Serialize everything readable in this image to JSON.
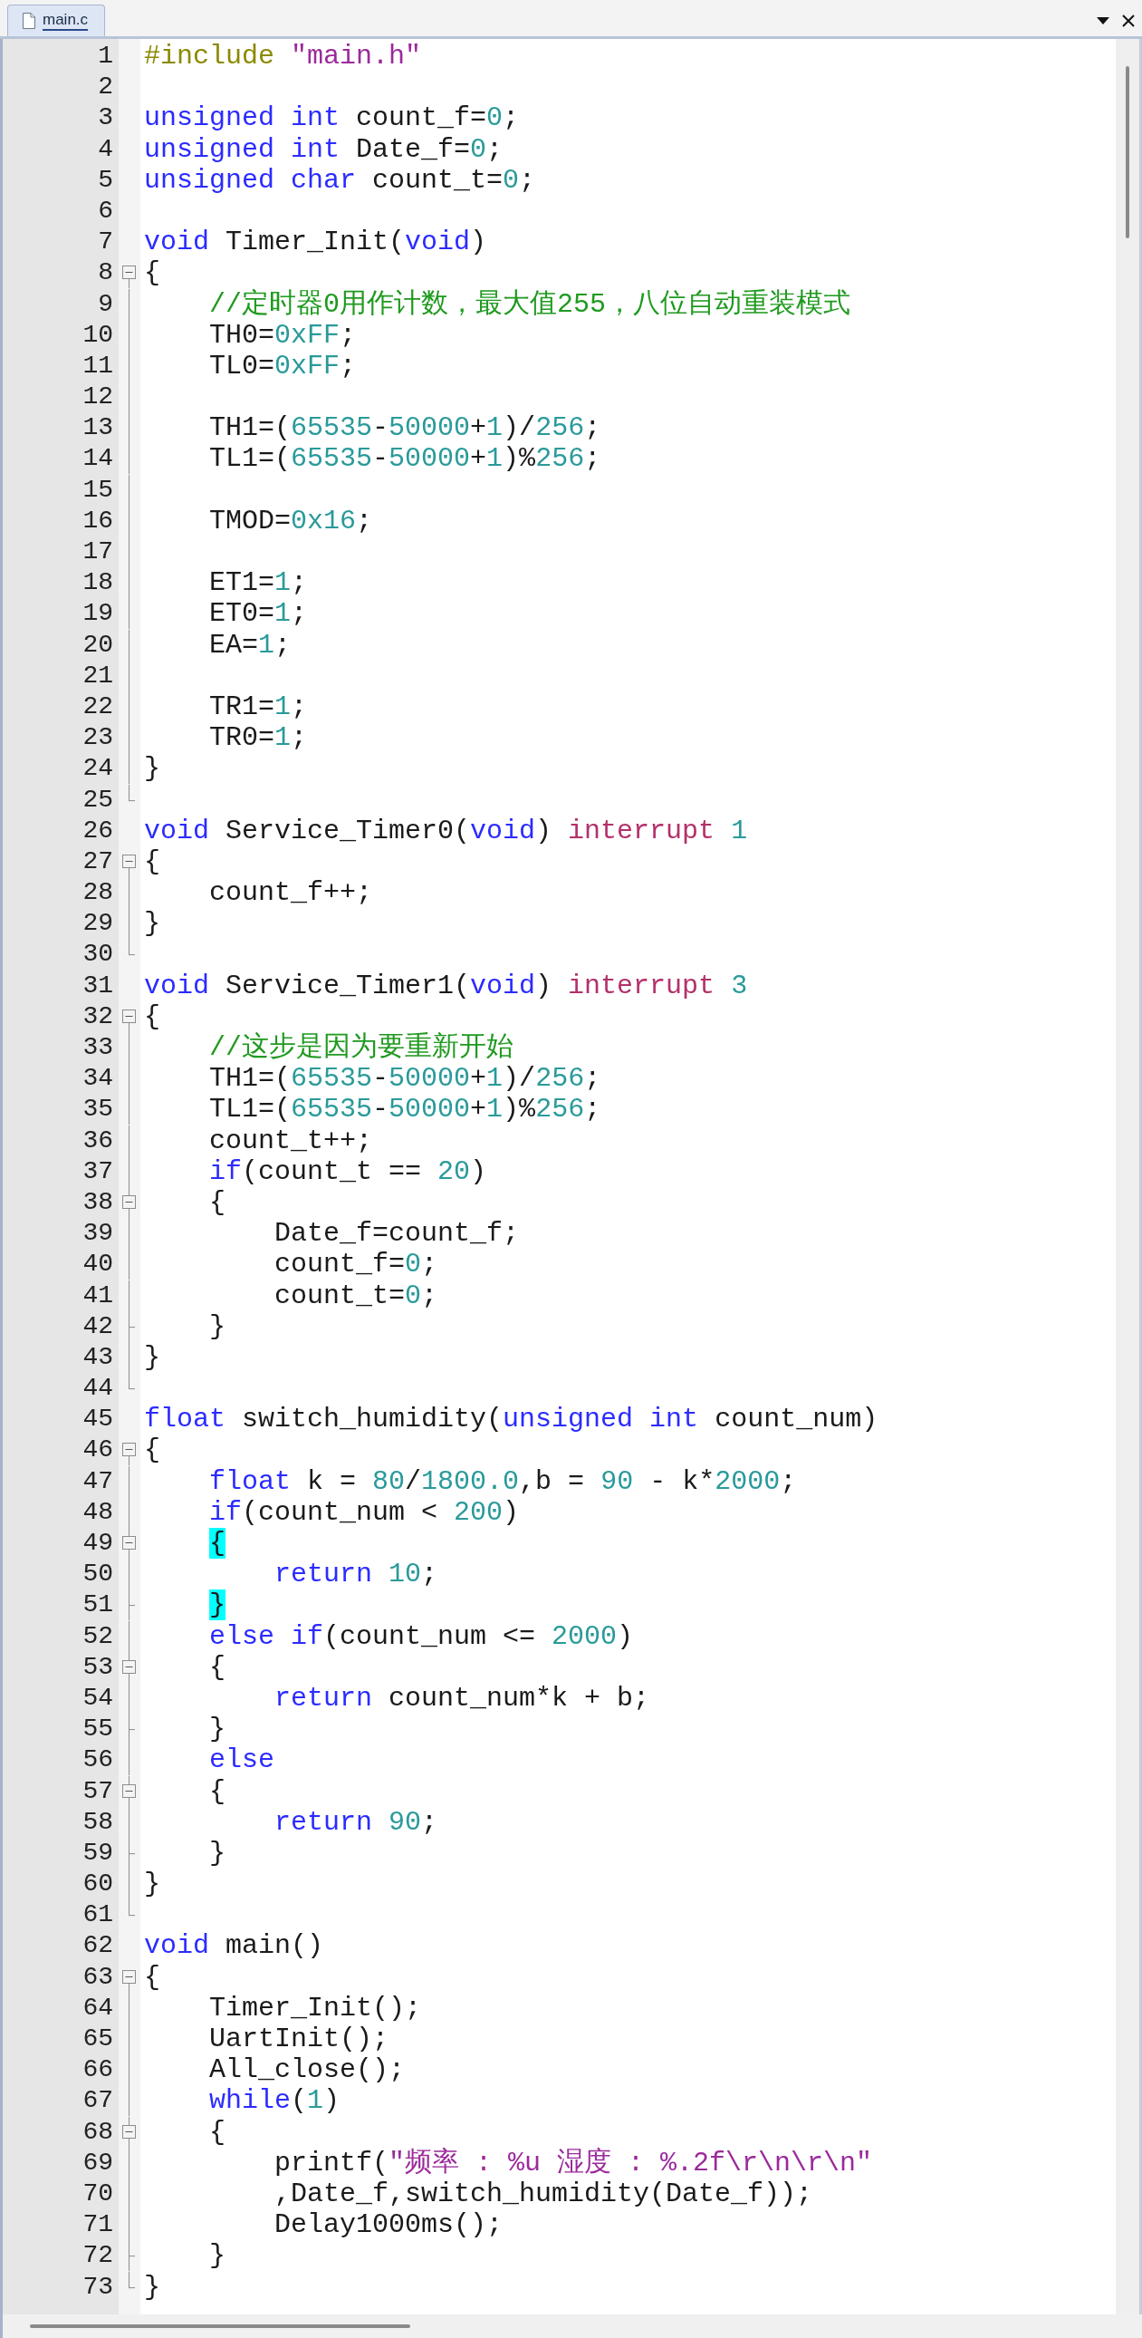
{
  "tab": {
    "label": "main.c",
    "selected": true
  },
  "lines": [
    {
      "number": "1",
      "kind": "code",
      "tokens": [
        {
          "kind": "preproc",
          "text": "#include "
        },
        {
          "kind": "string",
          "text": "\"main.h\""
        }
      ]
    },
    {
      "number": "2",
      "kind": "code"
    },
    {
      "number": "3",
      "kind": "code",
      "tokens": [
        {
          "kind": "keyword",
          "text": "unsigned"
        },
        {
          "kind": "keyword",
          "text": " int"
        },
        {
          "kind": "plain",
          "text": " count_f="
        },
        {
          "kind": "number",
          "text": "0"
        },
        {
          "kind": "plain",
          "text": ";"
        }
      ]
    },
    {
      "number": "4",
      "kind": "code",
      "tokens": [
        {
          "kind": "keyword",
          "text": "unsigned"
        },
        {
          "kind": "keyword",
          "text": " int"
        },
        {
          "kind": "plain",
          "text": " Date_f="
        },
        {
          "kind": "number",
          "text": "0"
        },
        {
          "kind": "plain",
          "text": ";"
        }
      ]
    },
    {
      "number": "5",
      "kind": "code",
      "tokens": [
        {
          "kind": "keyword",
          "text": "unsigned"
        },
        {
          "kind": "keyword",
          "text": " char"
        },
        {
          "kind": "plain",
          "text": " count_t="
        },
        {
          "kind": "number",
          "text": "0"
        },
        {
          "kind": "plain",
          "text": ";"
        }
      ]
    },
    {
      "number": "6",
      "kind": "code"
    },
    {
      "number": "7",
      "kind": "code",
      "tokens": [
        {
          "kind": "keyword",
          "text": "void"
        },
        {
          "kind": "plain",
          "text": " Timer_Init("
        },
        {
          "kind": "keyword",
          "text": "void"
        },
        {
          "kind": "plain",
          "text": ")"
        }
      ]
    },
    {
      "number": "8",
      "kind": "start",
      "expanded": true,
      "tokens": [
        {
          "kind": "plain",
          "text": "{"
        }
      ]
    },
    {
      "number": "9",
      "kind": "body",
      "tokens": [
        {
          "kind": "comment",
          "text": "    //定时器0用作计数，最大值255，八位自动重装模式"
        }
      ]
    },
    {
      "number": "10",
      "kind": "body",
      "tokens": [
        {
          "kind": "plain",
          "text": "    TH0="
        },
        {
          "kind": "number",
          "text": "0xFF"
        },
        {
          "kind": "plain",
          "text": ";"
        }
      ]
    },
    {
      "number": "11",
      "kind": "body",
      "tokens": [
        {
          "kind": "plain",
          "text": "    TL0="
        },
        {
          "kind": "number",
          "text": "0xFF"
        },
        {
          "kind": "plain",
          "text": ";"
        }
      ]
    },
    {
      "number": "12",
      "kind": "body"
    },
    {
      "number": "13",
      "kind": "body",
      "tokens": [
        {
          "kind": "plain",
          "text": "    TH1=("
        },
        {
          "kind": "number",
          "text": "65535"
        },
        {
          "kind": "plain",
          "text": "-"
        },
        {
          "kind": "number",
          "text": "50000"
        },
        {
          "kind": "plain",
          "text": "+"
        },
        {
          "kind": "number",
          "text": "1"
        },
        {
          "kind": "plain",
          "text": ")/"
        },
        {
          "kind": "number",
          "text": "256"
        },
        {
          "kind": "plain",
          "text": ";"
        }
      ]
    },
    {
      "number": "14",
      "kind": "body",
      "tokens": [
        {
          "kind": "plain",
          "text": "    TL1=("
        },
        {
          "kind": "number",
          "text": "65535"
        },
        {
          "kind": "plain",
          "text": "-"
        },
        {
          "kind": "number",
          "text": "50000"
        },
        {
          "kind": "plain",
          "text": "+"
        },
        {
          "kind": "number",
          "text": "1"
        },
        {
          "kind": "plain",
          "text": ")%"
        },
        {
          "kind": "number",
          "text": "256"
        },
        {
          "kind": "plain",
          "text": ";"
        }
      ]
    },
    {
      "number": "15",
      "kind": "body"
    },
    {
      "number": "16",
      "kind": "body",
      "tokens": [
        {
          "kind": "plain",
          "text": "    TMOD="
        },
        {
          "kind": "number",
          "text": "0x16"
        },
        {
          "kind": "plain",
          "text": ";"
        }
      ]
    },
    {
      "number": "17",
      "kind": "body"
    },
    {
      "number": "18",
      "kind": "body",
      "tokens": [
        {
          "kind": "plain",
          "text": "    ET1="
        },
        {
          "kind": "number",
          "text": "1"
        },
        {
          "kind": "plain",
          "text": ";"
        }
      ]
    },
    {
      "number": "19",
      "kind": "body",
      "tokens": [
        {
          "kind": "plain",
          "text": "    ET0="
        },
        {
          "kind": "number",
          "text": "1"
        },
        {
          "kind": "plain",
          "text": ";"
        }
      ]
    },
    {
      "number": "20",
      "kind": "body",
      "tokens": [
        {
          "kind": "plain",
          "text": "    EA="
        },
        {
          "kind": "number",
          "text": "1"
        },
        {
          "kind": "plain",
          "text": ";"
        }
      ]
    },
    {
      "number": "21",
      "kind": "body"
    },
    {
      "number": "22",
      "kind": "body",
      "tokens": [
        {
          "kind": "plain",
          "text": "    TR1="
        },
        {
          "kind": "number",
          "text": "1"
        },
        {
          "kind": "plain",
          "text": ";"
        }
      ]
    },
    {
      "number": "23",
      "kind": "body",
      "tokens": [
        {
          "kind": "plain",
          "text": "    TR0="
        },
        {
          "kind": "number",
          "text": "1"
        },
        {
          "kind": "plain",
          "text": ";"
        }
      ]
    },
    {
      "number": "24",
      "kind": "body",
      "tokens": [
        {
          "kind": "plain",
          "text": "}"
        }
      ]
    },
    {
      "number": "25",
      "kind": "end"
    },
    {
      "number": "26",
      "kind": "code",
      "tokens": [
        {
          "kind": "keyword",
          "text": "void"
        },
        {
          "kind": "plain",
          "text": " Service_Timer0("
        },
        {
          "kind": "keyword",
          "text": "void"
        },
        {
          "kind": "plain",
          "text": ") "
        },
        {
          "kind": "interrupt",
          "text": "interrupt"
        },
        {
          "kind": "number",
          "text": " 1"
        }
      ]
    },
    {
      "number": "27",
      "kind": "start",
      "expanded": true,
      "tokens": [
        {
          "kind": "plain",
          "text": "{"
        }
      ]
    },
    {
      "number": "28",
      "kind": "body",
      "tokens": [
        {
          "kind": "plain",
          "text": "    count_f++;"
        }
      ]
    },
    {
      "number": "29",
      "kind": "body",
      "tokens": [
        {
          "kind": "plain",
          "text": "}"
        }
      ]
    },
    {
      "number": "30",
      "kind": "end"
    },
    {
      "number": "31",
      "kind": "code",
      "tokens": [
        {
          "kind": "keyword",
          "text": "void"
        },
        {
          "kind": "plain",
          "text": " Service_Timer1("
        },
        {
          "kind": "keyword",
          "text": "void"
        },
        {
          "kind": "plain",
          "text": ") "
        },
        {
          "kind": "interrupt",
          "text": "interrupt"
        },
        {
          "kind": "number",
          "text": " 3"
        }
      ]
    },
    {
      "number": "32",
      "kind": "start",
      "expanded": true,
      "tokens": [
        {
          "kind": "plain",
          "text": "{"
        }
      ]
    },
    {
      "number": "33",
      "kind": "body",
      "tokens": [
        {
          "kind": "comment",
          "text": "    //这步是因为要重新开始"
        }
      ]
    },
    {
      "number": "34",
      "kind": "body",
      "tokens": [
        {
          "kind": "plain",
          "text": "    TH1=("
        },
        {
          "kind": "number",
          "text": "65535"
        },
        {
          "kind": "plain",
          "text": "-"
        },
        {
          "kind": "number",
          "text": "50000"
        },
        {
          "kind": "plain",
          "text": "+"
        },
        {
          "kind": "number",
          "text": "1"
        },
        {
          "kind": "plain",
          "text": ")/"
        },
        {
          "kind": "number",
          "text": "256"
        },
        {
          "kind": "plain",
          "text": ";"
        }
      ]
    },
    {
      "number": "35",
      "kind": "body",
      "tokens": [
        {
          "kind": "plain",
          "text": "    TL1=("
        },
        {
          "kind": "number",
          "text": "65535"
        },
        {
          "kind": "plain",
          "text": "-"
        },
        {
          "kind": "number",
          "text": "50000"
        },
        {
          "kind": "plain",
          "text": "+"
        },
        {
          "kind": "number",
          "text": "1"
        },
        {
          "kind": "plain",
          "text": ")%"
        },
        {
          "kind": "number",
          "text": "256"
        },
        {
          "kind": "plain",
          "text": ";"
        }
      ]
    },
    {
      "number": "36",
      "kind": "body",
      "tokens": [
        {
          "kind": "plain",
          "text": "    count_t++;"
        }
      ]
    },
    {
      "number": "37",
      "kind": "body",
      "tokens": [
        {
          "kind": "keyword",
          "text": "    if"
        },
        {
          "kind": "plain",
          "text": "(count_t == "
        },
        {
          "kind": "number",
          "text": "20"
        },
        {
          "kind": "plain",
          "text": ")"
        }
      ]
    },
    {
      "number": "38",
      "kind": "start",
      "expanded": true,
      "tokens": [
        {
          "kind": "plain",
          "text": "    {"
        }
      ]
    },
    {
      "number": "39",
      "kind": "body",
      "tokens": [
        {
          "kind": "plain",
          "text": "        Date_f=count_f;"
        }
      ]
    },
    {
      "number": "40",
      "kind": "body",
      "tokens": [
        {
          "kind": "plain",
          "text": "        count_f="
        },
        {
          "kind": "number",
          "text": "0"
        },
        {
          "kind": "plain",
          "text": ";"
        }
      ]
    },
    {
      "number": "41",
      "kind": "body",
      "tokens": [
        {
          "kind": "plain",
          "text": "        count_t="
        },
        {
          "kind": "number",
          "text": "0"
        },
        {
          "kind": "plain",
          "text": ";"
        }
      ]
    },
    {
      "number": "42",
      "kind": "tick",
      "tokens": [
        {
          "kind": "plain",
          "text": "    }"
        }
      ]
    },
    {
      "number": "43",
      "kind": "body",
      "tokens": [
        {
          "kind": "plain",
          "text": "}"
        }
      ]
    },
    {
      "number": "44",
      "kind": "end"
    },
    {
      "number": "45",
      "kind": "code",
      "tokens": [
        {
          "kind": "keyword",
          "text": "float"
        },
        {
          "kind": "plain",
          "text": " switch_humidity("
        },
        {
          "kind": "keyword",
          "text": "unsigned"
        },
        {
          "kind": "keyword",
          "text": " int"
        },
        {
          "kind": "plain",
          "text": " count_num)"
        }
      ]
    },
    {
      "number": "46",
      "kind": "start",
      "expanded": true,
      "tokens": [
        {
          "kind": "plain",
          "text": "{"
        }
      ]
    },
    {
      "number": "47",
      "kind": "body",
      "tokens": [
        {
          "kind": "keyword",
          "text": "    float"
        },
        {
          "kind": "plain",
          "text": " k = "
        },
        {
          "kind": "number",
          "text": "80"
        },
        {
          "kind": "plain",
          "text": "/"
        },
        {
          "kind": "number",
          "text": "1800.0"
        },
        {
          "kind": "plain",
          "text": ",b = "
        },
        {
          "kind": "number",
          "text": "90"
        },
        {
          "kind": "plain",
          "text": " - k*"
        },
        {
          "kind": "number",
          "text": "2000"
        },
        {
          "kind": "plain",
          "text": ";"
        }
      ]
    },
    {
      "number": "48",
      "kind": "body",
      "tokens": [
        {
          "kind": "keyword",
          "text": "    if"
        },
        {
          "kind": "plain",
          "text": "(count_num < "
        },
        {
          "kind": "number",
          "text": "200"
        },
        {
          "kind": "plain",
          "text": ")"
        }
      ]
    },
    {
      "number": "49",
      "kind": "start",
      "expanded": true,
      "tokens": [
        {
          "kind": "match",
          "text": "    {"
        }
      ]
    },
    {
      "number": "50",
      "kind": "body",
      "tokens": [
        {
          "kind": "keyword",
          "text": "        return"
        },
        {
          "kind": "number",
          "text": " 10"
        },
        {
          "kind": "plain",
          "text": ";"
        }
      ]
    },
    {
      "number": "51",
      "kind": "tick",
      "tokens": [
        {
          "kind": "match",
          "text": "    }"
        }
      ]
    },
    {
      "number": "52",
      "kind": "body",
      "tokens": [
        {
          "kind": "keyword",
          "text": "    else"
        },
        {
          "kind": "keyword",
          "text": " if"
        },
        {
          "kind": "plain",
          "text": "(count_num <= "
        },
        {
          "kind": "number",
          "text": "2000"
        },
        {
          "kind": "plain",
          "text": ")"
        }
      ]
    },
    {
      "number": "53",
      "kind": "start",
      "expanded": true,
      "tokens": [
        {
          "kind": "plain",
          "text": "    {"
        }
      ]
    },
    {
      "number": "54",
      "kind": "body",
      "tokens": [
        {
          "kind": "keyword",
          "text": "        return"
        },
        {
          "kind": "plain",
          "text": " count_num*k + b;"
        }
      ]
    },
    {
      "number": "55",
      "kind": "tick",
      "tokens": [
        {
          "kind": "plain",
          "text": "    }"
        }
      ]
    },
    {
      "number": "56",
      "kind": "body",
      "tokens": [
        {
          "kind": "keyword",
          "text": "    else"
        }
      ]
    },
    {
      "number": "57",
      "kind": "start",
      "expanded": true,
      "tokens": [
        {
          "kind": "plain",
          "text": "    {"
        }
      ]
    },
    {
      "number": "58",
      "kind": "body",
      "tokens": [
        {
          "kind": "keyword",
          "text": "        return"
        },
        {
          "kind": "number",
          "text": " 90"
        },
        {
          "kind": "plain",
          "text": ";"
        }
      ]
    },
    {
      "number": "59",
      "kind": "tick",
      "tokens": [
        {
          "kind": "plain",
          "text": "    }"
        }
      ]
    },
    {
      "number": "60",
      "kind": "body",
      "tokens": [
        {
          "kind": "plain",
          "text": "}"
        }
      ]
    },
    {
      "number": "61",
      "kind": "end"
    },
    {
      "number": "62",
      "kind": "code",
      "tokens": [
        {
          "kind": "keyword",
          "text": "void"
        },
        {
          "kind": "plain",
          "text": " main()"
        }
      ]
    },
    {
      "number": "63",
      "kind": "start",
      "expanded": true,
      "tokens": [
        {
          "kind": "plain",
          "text": "{"
        }
      ]
    },
    {
      "number": "64",
      "kind": "body",
      "tokens": [
        {
          "kind": "plain",
          "text": "    Timer_Init();"
        }
      ]
    },
    {
      "number": "65",
      "kind": "body",
      "tokens": [
        {
          "kind": "plain",
          "text": "    UartInit();"
        }
      ]
    },
    {
      "number": "66",
      "kind": "body",
      "tokens": [
        {
          "kind": "plain",
          "text": "    All_close();"
        }
      ]
    },
    {
      "number": "67",
      "kind": "body",
      "tokens": [
        {
          "kind": "keyword",
          "text": "    while"
        },
        {
          "kind": "plain",
          "text": "("
        },
        {
          "kind": "number",
          "text": "1"
        },
        {
          "kind": "plain",
          "text": ")"
        }
      ]
    },
    {
      "number": "68",
      "kind": "start",
      "expanded": true,
      "tokens": [
        {
          "kind": "plain",
          "text": "    {"
        }
      ]
    },
    {
      "number": "69",
      "kind": "body",
      "tokens": [
        {
          "kind": "plain",
          "text": "        printf("
        },
        {
          "kind": "string",
          "text": "\"频率 : %u 湿度 : %.2f\\r\\n\\r\\n\""
        }
      ]
    },
    {
      "number": "70",
      "kind": "body",
      "tokens": [
        {
          "kind": "plain",
          "text": "        ,Date_f,switch_humidity(Date_f));"
        }
      ]
    },
    {
      "number": "71",
      "kind": "body",
      "tokens": [
        {
          "kind": "plain",
          "text": "        Delay1000ms();"
        }
      ]
    },
    {
      "number": "72",
      "kind": "tick",
      "tokens": [
        {
          "kind": "plain",
          "text": "    }"
        }
      ]
    },
    {
      "number": "73",
      "kind": "end",
      "tokens": [
        {
          "kind": "plain",
          "text": "}"
        }
      ]
    }
  ]
}
